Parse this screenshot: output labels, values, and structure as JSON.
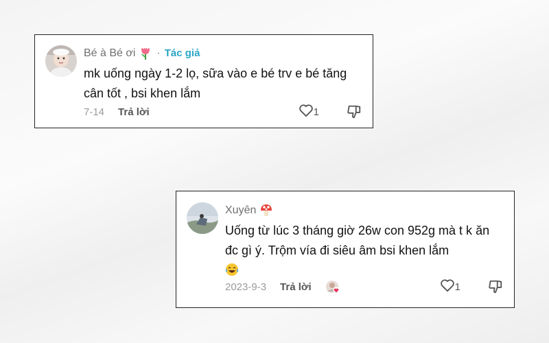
{
  "comments": [
    {
      "username": "Bé à Bé ơi",
      "username_emoji": "tulip",
      "separator": "·",
      "author_tag": "Tác giả",
      "text": "mk uống ngày 1-2 lọ, sữa vào e bé trv e bé tăng cân tốt , bsi khen lắm",
      "date": "7-14",
      "reply_label": "Trả lời",
      "like_count": "1"
    },
    {
      "username": "Xuyên",
      "username_emoji": "mushroom",
      "text": "Uống từ lúc 3 tháng giờ 26w con 952g mà t k ăn đc gì ý. Trộm vía đi siêu âm bsi khen lắm",
      "text_emoji": "laughing-face",
      "date": "2023-9-3",
      "reply_label": "Trả lời",
      "like_count": "1"
    }
  ],
  "colors": {
    "author_tag": "#2aa6c6",
    "heart_badge": "#e8335a"
  }
}
